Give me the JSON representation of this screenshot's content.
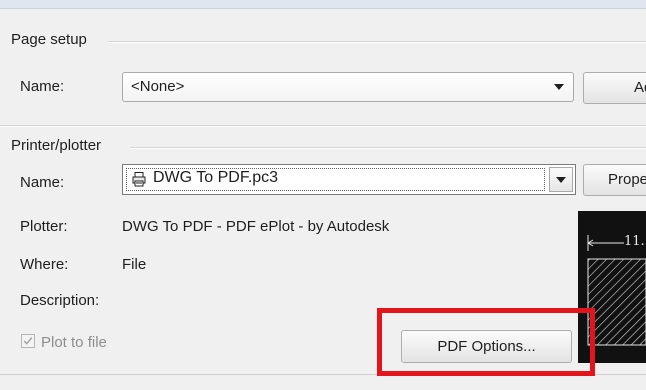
{
  "page_setup": {
    "title": "Page setup",
    "name_label": "Name:",
    "name_value": "<None>",
    "add_button_label": "Ad"
  },
  "printer_plotter": {
    "title": "Printer/plotter",
    "name_label": "Name:",
    "name_value": "DWG To PDF.pc3",
    "properties_button_label": "Prope",
    "plotter_label": "Plotter:",
    "plotter_value": "DWG To PDF - PDF ePlot - by Autodesk",
    "where_label": "Where:",
    "where_value": "File",
    "description_label": "Description:",
    "plot_to_file_label": "Plot to file",
    "pdf_options_label": "PDF Options...",
    "preview_dimension_label": "11."
  },
  "colors": {
    "highlight": "#e3141b"
  },
  "icons": {
    "printer": "printer-icon",
    "dropdown": "chevron-down-icon",
    "check": "check-icon"
  }
}
